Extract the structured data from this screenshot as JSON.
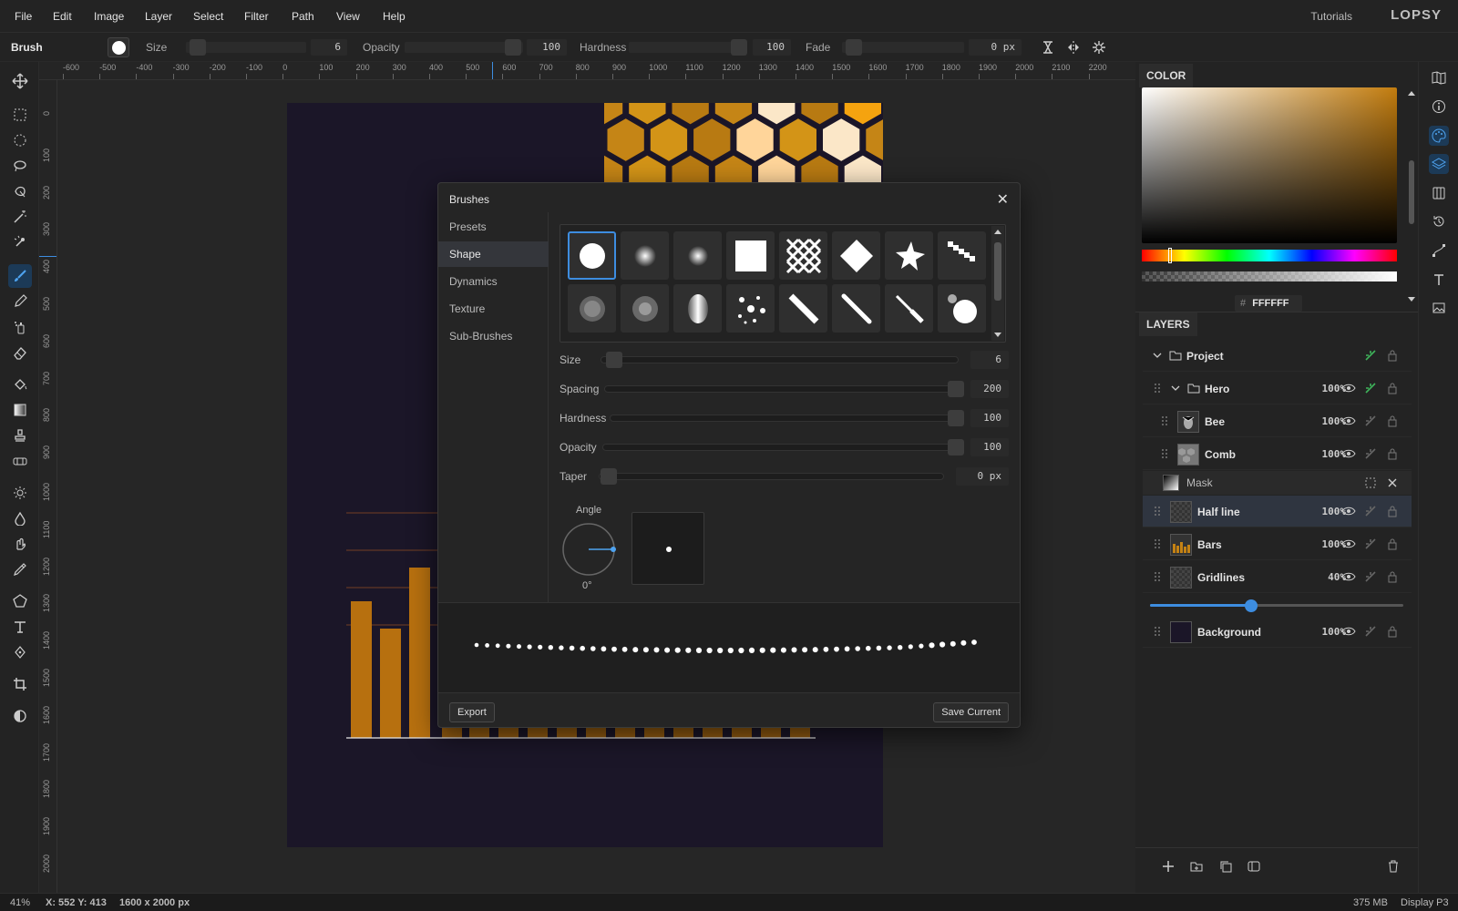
{
  "menu": [
    "File",
    "Edit",
    "Image",
    "Layer",
    "Select",
    "Filter",
    "Path",
    "View",
    "Help"
  ],
  "header": {
    "tutorials": "Tutorials",
    "logo": "LOPSY"
  },
  "options": {
    "tool": "Brush",
    "size_label": "Size",
    "size_value": "6",
    "opacity_label": "Opacity",
    "opacity_value": "100",
    "hardness_label": "Hardness",
    "hardness_value": "100",
    "fade_label": "Fade",
    "fade_value": "0 px"
  },
  "ruler": {
    "h": [
      "-600",
      "-500",
      "-400",
      "-300",
      "-200",
      "-100",
      "0",
      "100",
      "200",
      "300",
      "400",
      "500",
      "600",
      "700",
      "800",
      "900",
      "1000",
      "1100",
      "1200",
      "1300",
      "1400",
      "1500",
      "1600",
      "1700",
      "1800",
      "1900",
      "2000",
      "2100",
      "2200"
    ],
    "v": [
      "0",
      "100",
      "200",
      "300",
      "400",
      "500",
      "600",
      "700",
      "800",
      "900",
      "1000",
      "1100",
      "1200",
      "1300",
      "1400",
      "1500",
      "1600",
      "1700",
      "1800",
      "1900",
      "2000"
    ]
  },
  "dialog": {
    "title": "Brushes",
    "tabs": [
      "Presets",
      "Shape",
      "Dynamics",
      "Texture",
      "Sub-Brushes"
    ],
    "active_tab": "Shape",
    "brushes": [
      "round-hard",
      "round-soft",
      "round-softer",
      "square",
      "crosshatch",
      "diamond",
      "star",
      "scatter-stair",
      "noise-round",
      "noise-dense",
      "leaf",
      "splatter",
      "line-thick",
      "line-medium",
      "line-thin",
      "bubble"
    ],
    "size_label": "Size",
    "size_value": "6",
    "spacing_label": "Spacing",
    "spacing_value": "200",
    "hardness_label": "Hardness",
    "hardness_value": "100",
    "opacity_label": "Opacity",
    "opacity_value": "100",
    "taper_label": "Taper",
    "taper_value": "0 px",
    "angle_label": "Angle",
    "angle_value": "0°",
    "export_label": "Export",
    "save_label": "Save Current"
  },
  "color": {
    "tab": "COLOR",
    "hex_prefix": "#",
    "hex": "FFFFFF"
  },
  "layers": {
    "tab": "LAYERS",
    "rows": [
      {
        "name": "Project",
        "opacity": "",
        "type": "group"
      },
      {
        "name": "Hero",
        "opacity": "100%",
        "type": "group"
      },
      {
        "name": "Bee",
        "opacity": "100%",
        "type": "layer"
      },
      {
        "name": "Comb",
        "opacity": "100%",
        "type": "layer"
      },
      {
        "name": "Mask",
        "opacity": "",
        "type": "mask"
      },
      {
        "name": "Half line",
        "opacity": "100%",
        "type": "layer"
      },
      {
        "name": "Bars",
        "opacity": "100%",
        "type": "layer"
      },
      {
        "name": "Gridlines",
        "opacity": "40%",
        "type": "layer"
      },
      {
        "name": "Background",
        "opacity": "100%",
        "type": "layer"
      }
    ],
    "gridlines_opacity_slider": 0.4
  },
  "status": {
    "zoom": "41%",
    "coords": "X: 552  Y: 413",
    "doc_size": "1600 x 2000 px",
    "memory": "375 MB",
    "profile": "Display P3"
  }
}
